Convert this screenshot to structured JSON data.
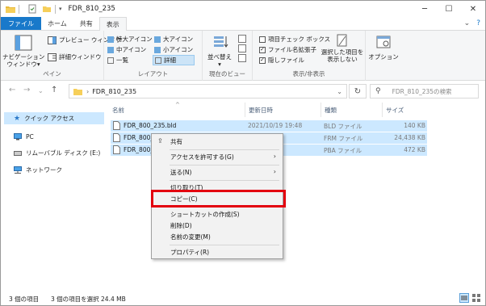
{
  "window": {
    "title": "FDR_810_235"
  },
  "ribbon_tabs": [
    "ファイル",
    "ホーム",
    "共有",
    "表示"
  ],
  "ribbon": {
    "pane_group": {
      "label": "ペイン",
      "nav_pane": "ナビゲーション\nウィンドウ▾",
      "preview": "プレビュー ウィンドウ",
      "details": "詳細ウィンドウ"
    },
    "layout_group": {
      "label": "レイアウト",
      "items": [
        "特大アイコン",
        "大アイコン",
        "中アイコン",
        "小アイコン",
        "一覧",
        "詳細"
      ]
    },
    "current_view_group": {
      "label": "現在のビュー",
      "sort": "並べ替え\n▾"
    },
    "show_hide_group": {
      "label": "表示/非表示",
      "checkboxes": [
        {
          "label": "項目チェック ボックス",
          "checked": false
        },
        {
          "label": "ファイル名拡張子",
          "checked": true
        },
        {
          "label": "隠しファイル",
          "checked": true
        }
      ],
      "hide_selected": "選択した項目を\n表示しない"
    },
    "options": {
      "label": "オプション"
    }
  },
  "address": {
    "path": "FDR_810_235",
    "search_placeholder": "FDR_810_235の検索"
  },
  "nav_pane": [
    {
      "label": "クイック アクセス",
      "icon": "star-icon"
    },
    {
      "label": "PC",
      "icon": "pc-icon"
    },
    {
      "label": "リムーバブル ディスク (E:)",
      "icon": "drive-icon"
    },
    {
      "label": "ネットワーク",
      "icon": "network-icon"
    }
  ],
  "columns": [
    "名前",
    "更新日時",
    "種類",
    "サイズ"
  ],
  "files": [
    {
      "name": "FDR_800_235.bld",
      "date": "2021/10/19 19:48",
      "type": "BLD ファイル",
      "size": "140 KB"
    },
    {
      "name": "FDR_800_23",
      "date": "",
      "type": "FRM ファイル",
      "size": "24,438 KB"
    },
    {
      "name": "FDR_800_2",
      "date": "",
      "type": "PBA ファイル",
      "size": "472 KB"
    }
  ],
  "context_menu": {
    "share": "共有",
    "grant_access": "アクセスを許可する(G)",
    "send_to": "送る(N)",
    "cut": "切り取り(T)",
    "copy": "コピー(C)",
    "create_shortcut": "ショートカットの作成(S)",
    "delete": "削除(D)",
    "rename": "名前の変更(M)",
    "properties": "プロパティ(R)"
  },
  "status": {
    "item_count": "3 個の項目",
    "selected": "3 個の項目を選択  24.4 MB"
  },
  "colors": {
    "file_tab": "#1979ca",
    "selection": "#cce8ff",
    "highlight_box": "#e3000f"
  }
}
